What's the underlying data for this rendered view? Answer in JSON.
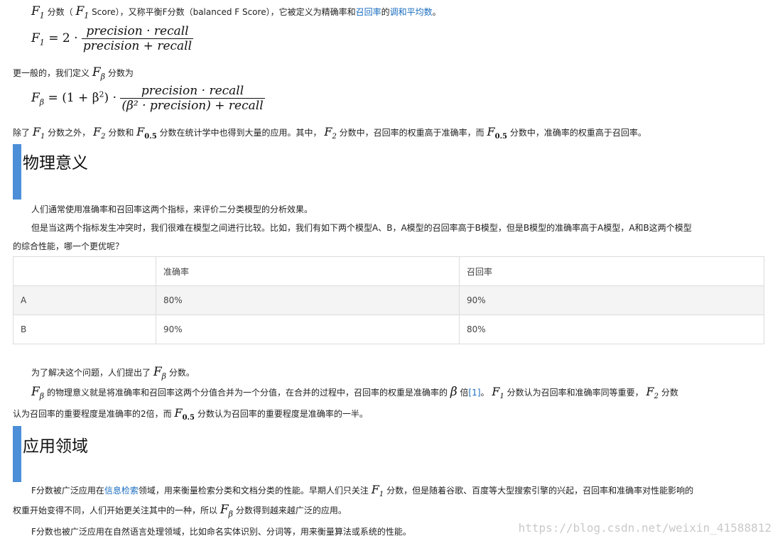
{
  "intro": {
    "f1": "F",
    "f1_sub": "1",
    "t1": " 分数（",
    "t2": " Score），又称平衡F分数（balanced F Score），它被定义为精确率和",
    "link_recall": "召回率",
    "t3": "的",
    "link_harmonic": "调和平均数",
    "t4": "。"
  },
  "formula1": {
    "lhs": "F",
    "lhs_sub": "1",
    "eq": " = 2 · ",
    "num": "precision · recall",
    "den": "precision + recall"
  },
  "general": {
    "t1": "更一般的，我们定义",
    "fb": "F",
    "fb_sub": "β",
    "t2": "分数为"
  },
  "formula2": {
    "lhs": "F",
    "lhs_sub": "β",
    "eq": " = (1 + β",
    "sup": "2",
    "eq2": ") · ",
    "num": "precision · recall",
    "den": "(β² · precision) + recall"
  },
  "besides": {
    "t1": "除了",
    "t2": "分数之外，",
    "t3": "分数和",
    "t4": "分数在统计学中也得到大量的应用。其中，",
    "t5": "分数中，召回率的权重高于准确率，而",
    "t6": "分数中，准确率的权重高于召回率。",
    "sub1": "1",
    "sub2": "2",
    "sub05": "0.5",
    "f": "F"
  },
  "section1": {
    "title": "物理意义"
  },
  "para1": "人们通常使用准确率和召回率这两个指标，来评价二分类模型的分析效果。",
  "para2a": "但是当这两个指标发生冲突时，我们很难在模型之间进行比较。比如，我们有如下两个模型A、B，A模型的召回率高于B模型，但是B模型的准确率高于A模型，A和B这两个模型",
  "para2b": "的综合性能，哪一个更优呢？",
  "table": {
    "headers": [
      "",
      "准确率",
      "召回率"
    ],
    "rows": [
      [
        "A",
        "80%",
        "90%"
      ],
      [
        "B",
        "90%",
        "80%"
      ]
    ]
  },
  "para3": {
    "t1": "为了解决这个问题，人们提出了",
    "t2": "分数。"
  },
  "para4": {
    "t1": "的物理意义就是将准确率和召回率这两个分值合并为一个分值，在合并的过程中，召回率的权重是准确率的",
    "beta": "β",
    "t2": "倍",
    "ref": "[1]",
    "t3": "。",
    "t4": "分数认为召回率和准确率同等重要，",
    "t5": "分数",
    "t6": "认为召回率的重要程度是准确率的2倍，而",
    "t7": "分数认为召回率的重要程度是准确率的一半。"
  },
  "section2": {
    "title": "应用领域"
  },
  "para5": {
    "t1": "F分数被广泛应用在",
    "link": "信息检索",
    "t2": "领域，用来衡量检索分类和文档分类的性能。早期人们只关注",
    "t3": "分数，但是随着谷歌、百度等大型搜索引擎的兴起，召回率和准确率对性能影响的",
    "t4": "权重开始变得不同，人们开始更关注其中的一种，所以",
    "t5": "分数得到越来越广泛的应用。"
  },
  "para6": "F分数也被广泛应用在自然语言处理领域，比如命名实体识别、分词等，用来衡量算法或系统的性能。",
  "watermark": "https://blog.csdn.net/weixin_41588812"
}
